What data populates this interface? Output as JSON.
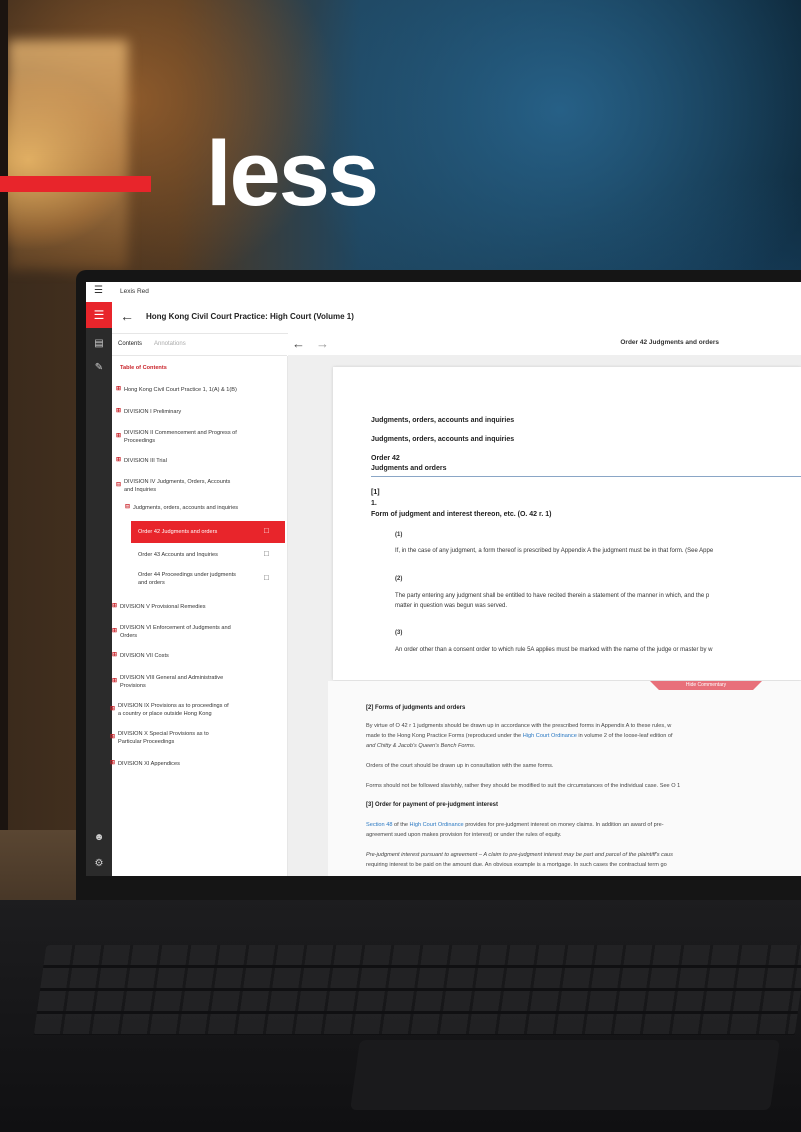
{
  "headline": "less",
  "app": {
    "name": "Lexis Red",
    "book_title": "Hong Kong Civil Court Practice: High Court (Volume 1)"
  },
  "panel_tabs": {
    "contents": "Contents",
    "annotations": "Annotations"
  },
  "toc": {
    "heading": "Table of Contents",
    "items": [
      {
        "label": "Hong Kong Civil Court Practice 1, 1(A) & 1(B)"
      },
      {
        "label": "DIVISION I Preliminary"
      },
      {
        "label": "DIVISION II Commencement and Progress of",
        "label2": "Proceedings"
      },
      {
        "label": "DIVISION III Trial"
      },
      {
        "label": "DIVISION IV Judgments, Orders, Accounts",
        "label2": "and Inquiries"
      },
      {
        "label": "Judgments, orders, accounts and inquiries"
      },
      {
        "label": "Order 42 Judgments and orders"
      },
      {
        "label": "Order 43 Accounts and Inquiries"
      },
      {
        "label": "Order 44 Proceedings under judgments",
        "label2": "and orders"
      },
      {
        "label": "DIVISION V Provisional Remedies"
      },
      {
        "label": "DIVISION VI Enforcement of Judgments and",
        "label2": "Orders"
      },
      {
        "label": "DIVISION VII Costs"
      },
      {
        "label": "DIVISION VIII General and Administrative",
        "label2": "Provisions"
      },
      {
        "label": "DIVISION IX Provisions as to proceedings of",
        "label2": "a country or place outside Hong Kong"
      },
      {
        "label": "DIVISION X Special Provisions as to",
        "label2": "Particular Proceedings"
      },
      {
        "label": "DIVISION XI Appendices"
      }
    ]
  },
  "docbar": {
    "title": "Order 42 Judgments and orders"
  },
  "document": {
    "h1": "Judgments, orders, accounts and inquiries",
    "h2": "Judgments, orders, accounts and inquiries",
    "order": "Order 42",
    "order_title": "Judgments and orders",
    "p_ref": "[1]",
    "r_num": "1.",
    "rule_title": "Form of judgment and interest thereon, etc. (O. 42 r. 1)",
    "s1": "(1)",
    "s1_text": "If, in the case of any judgment, a form thereof is prescribed by Appendix A the judgment must be in that form. (See Appe",
    "s2": "(2)",
    "s2_text": "The party entering any judgment shall be entitled to have recited therein a statement of the manner in which, and the p",
    "s2_text2": "matter in question was begun was served.",
    "s3": "(3)",
    "s3_text": "An order other than a consent order to which rule 5A applies must be marked with the name of the judge or master by w"
  },
  "commentary": {
    "hide_label": "Hide Commentary",
    "h_forms": "[2] Forms of judgments and orders",
    "p1a": "By virtue of O 42 r 1 judgments should be drawn up in accordance with the prescribed forms in Appendix A to these rules, w",
    "p1b_pre": "made to the Hong Kong Practice Forms (reproduced under the ",
    "p1b_link": "High Court Ordinance",
    "p1b_post": " in volume 2 of the loose-leaf edition of",
    "p1c": "and Chitty & Jacob's Queen's Bench Forms.",
    "p2": "Orders of the court should be drawn up in consultation with the same forms.",
    "p3": "Forms should not be followed slavishly, rather they should be modified to suit the circumstances of the individual case. See O 1",
    "h_interest": "[3] Order for payment of pre-judgment interest",
    "p4_link1": "Section 48",
    "p4_mid": " of the ",
    "p4_link2": "High Court Ordinance",
    "p4_post": " provides for pre-judgment interest on money claims. In addition an award of pre-",
    "p4b": "agreement sued upon makes provision for interest) or under the rules of equity.",
    "p5a": "Pre-judgment interest pursuant to agreement – A claim to pre-judgment interest may be part and parcel of the plaintiff's caus",
    "p5b": "requiring interest to be paid on the amount due. An obvious example is a mortgage. In such cases the contractual term go"
  },
  "colors": {
    "brand_red": "#e8252b",
    "link_blue": "#2a78c2"
  },
  "icons": [
    "hamburger-icon",
    "book-icon",
    "pencil-icon",
    "user-icon",
    "settings-icon",
    "back-arrow-icon",
    "forward-arrow-icon",
    "document-icon",
    "expand-icon",
    "collapse-icon"
  ]
}
